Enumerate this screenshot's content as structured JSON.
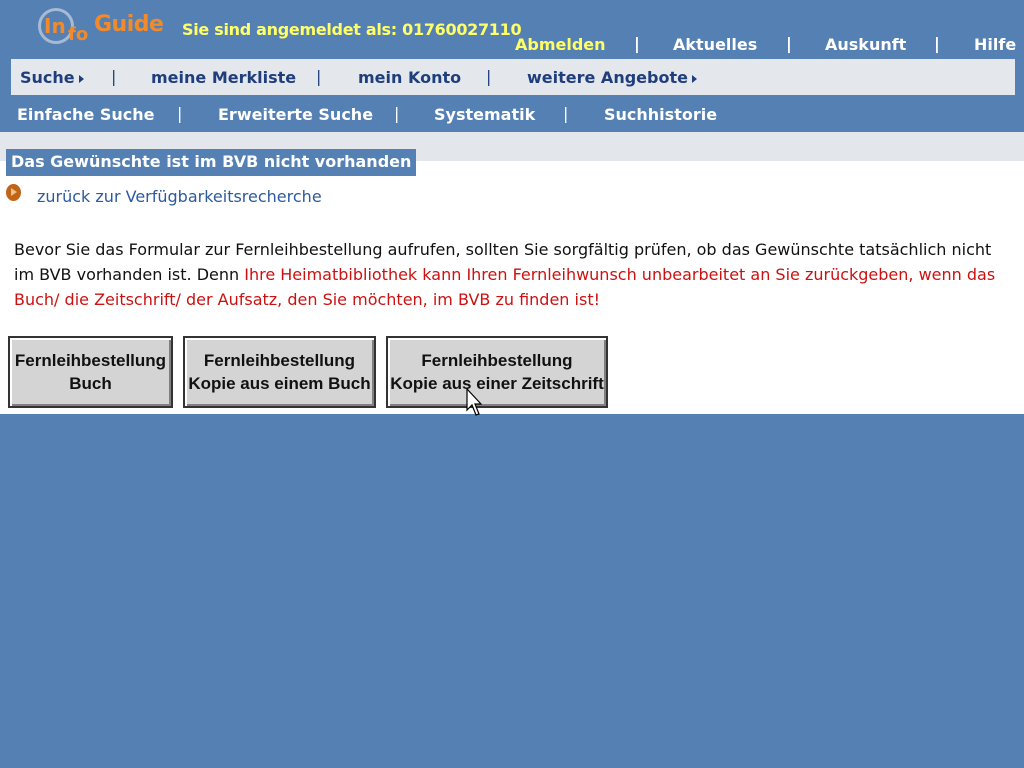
{
  "header": {
    "logo": {
      "part1": "In",
      "part2": "fo",
      "part3": "Guide"
    },
    "login_info": "Sie sind angemeldet als: 01760027110",
    "logout": "Abmelden",
    "links": [
      "Aktuelles",
      "Auskunft",
      "Hilfe"
    ],
    "separator": "|"
  },
  "main_nav": {
    "items": [
      "Suche",
      "meine Merkliste",
      "mein Konto",
      "weitere Angebote"
    ]
  },
  "sub_nav": {
    "items": [
      "Einfache Suche",
      "Erweiterte Suche",
      "Systematik",
      "Suchhistorie"
    ]
  },
  "content": {
    "title": "Das Gewünschte ist im BVB nicht vorhanden",
    "back_link": "zurück zur Verfügbarkeitsrecherche",
    "message_normal": "Bevor Sie das Formular zur Fernleihbestellung aufrufen, sollten Sie sorgfältig prüfen, ob das Gewünschte tatsächlich nicht im BVB vorhanden ist. Denn ",
    "message_warning": "Ihre Heimatbibliothek kann Ihren Fernleihwunsch unbearbeitet an Sie zurückgeben, wenn das Buch/ die Zeitschrift/ der Aufsatz, den Sie möchten, im BVB zu finden ist!",
    "buttons": [
      {
        "line1": "Fernleihbestellung",
        "line2": "Buch"
      },
      {
        "line1": "Fernleihbestellung",
        "line2": "Kopie aus einem Buch"
      },
      {
        "line1": "Fernleihbestellung",
        "line2": "Kopie aus einer Zeitschrift"
      }
    ]
  },
  "colors": {
    "background": "#5580b4",
    "nav_bar": "#e4e8ec",
    "login_text": "#ffff66",
    "logo": "#f08a2a",
    "warning_text": "#cc1111"
  }
}
